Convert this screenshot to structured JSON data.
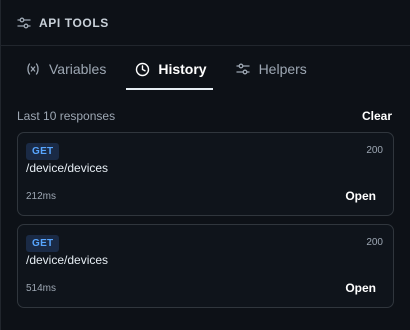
{
  "header": {
    "title": "API TOOLS",
    "icon": "sliders-icon"
  },
  "tabs": [
    {
      "label": "Variables",
      "icon": "variable-icon",
      "active": false
    },
    {
      "label": "History",
      "icon": "clock-icon",
      "active": true
    },
    {
      "label": "Helpers",
      "icon": "sliders-icon",
      "active": false
    }
  ],
  "history": {
    "label": "Last 10 responses",
    "clear_label": "Clear",
    "items": [
      {
        "method": "GET",
        "path": "/device/devices",
        "status": "200",
        "duration": "212ms",
        "open_label": "Open"
      },
      {
        "method": "GET",
        "path": "/device/devices",
        "status": "200",
        "duration": "514ms",
        "open_label": "Open"
      }
    ]
  },
  "colors": {
    "background": "#0d1117",
    "method_bg": "#1a2a45",
    "method_text": "#58a6ff",
    "active_tab": "#ffffff"
  }
}
